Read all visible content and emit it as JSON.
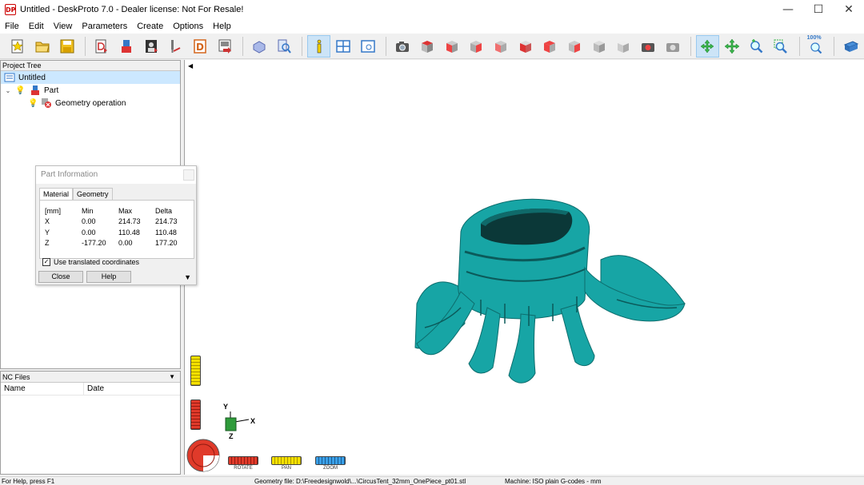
{
  "window": {
    "app_icon_text": "DP",
    "title": "Untitled - DeskProto 7.0 - Dealer license: Not For Resale!",
    "minimize": "—",
    "maximize": "☐",
    "close": "✕"
  },
  "menu": [
    "File",
    "Edit",
    "View",
    "Parameters",
    "Create",
    "Options",
    "Help"
  ],
  "toolbar": {
    "zoom_percent_label": "100%"
  },
  "project_tree": {
    "header": "Project Tree",
    "items": [
      {
        "label": "Untitled"
      },
      {
        "label": "Part"
      },
      {
        "label": "Geometry operation"
      }
    ]
  },
  "part_info": {
    "title": "Part Information",
    "tabs": [
      "Material",
      "Geometry"
    ],
    "headers": [
      "[mm]",
      "Min",
      "Max",
      "Delta"
    ],
    "rows": [
      [
        "X",
        "0.00",
        "214.73",
        "214.73"
      ],
      [
        "Y",
        "0.00",
        "110.48",
        "110.48"
      ],
      [
        "Z",
        "-177.20",
        "0.00",
        "177.20"
      ]
    ],
    "checkbox_label": "Use translated coordinates",
    "checkbox_checked": true,
    "close_label": "Close",
    "help_label": "Help"
  },
  "nc_files": {
    "header": "NC Files",
    "columns": [
      "Name",
      "Date"
    ]
  },
  "viewport": {
    "model_color": "#17a5a5",
    "axes": {
      "x": "X",
      "y": "Y",
      "z": "Z"
    },
    "controls": {
      "rotate_label": "ROTATE",
      "pan_label": "PAN",
      "zoom_label": "ZOOM"
    }
  },
  "status": {
    "help": "For Help, press F1",
    "geometry_file": "Geometry file: D:\\Freedesignwold\\...\\CircusTent_32mm_OnePiece_pt01.stl",
    "machine": "Machine: ISO plain G-codes - mm"
  }
}
